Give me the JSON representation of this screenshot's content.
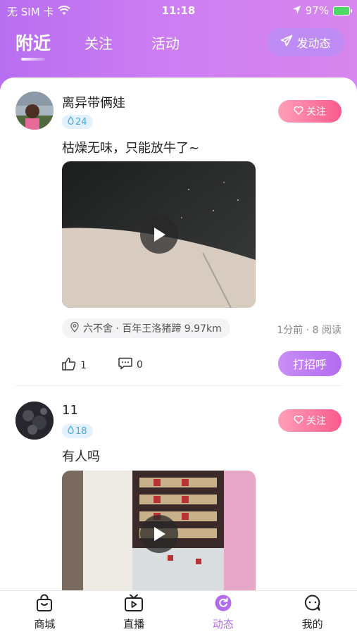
{
  "status_bar": {
    "carrier": "无 SIM 卡",
    "time": "11:18",
    "battery": "97%"
  },
  "tabs": {
    "nearby": "附近",
    "following": "关注",
    "activity": "活动",
    "post_label": "发动态"
  },
  "posts": [
    {
      "username": "离异带俩娃",
      "level": "24",
      "follow_label": "关注",
      "text": "枯燥无味，只能放牛了~",
      "location": "六不舍 · 百年王洛猪蹄 9.97km",
      "meta": "1分前 · 8 阅读",
      "likes": "1",
      "comments": "0",
      "greet_label": "打招呼"
    },
    {
      "username": "11",
      "level": "18",
      "follow_label": "关注",
      "text": "有人吗"
    }
  ],
  "bottom_nav": [
    {
      "label": "商城",
      "icon": "shopping-bag-icon"
    },
    {
      "label": "直播",
      "icon": "tv-play-icon"
    },
    {
      "label": "动态",
      "icon": "refresh-circle-icon",
      "active": true
    },
    {
      "label": "我的",
      "icon": "chat-person-icon"
    }
  ],
  "colors": {
    "accent": "#b36cf0",
    "follow": "#f85a8c",
    "level_badge": "#4aa7de"
  }
}
